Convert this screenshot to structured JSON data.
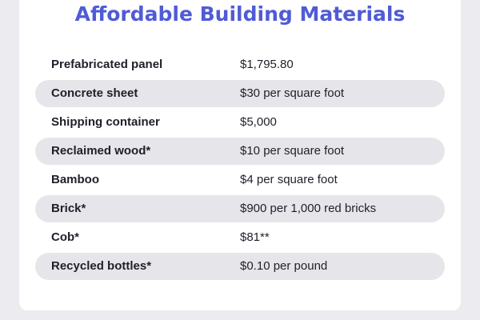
{
  "title": "Affordable Building Materials",
  "colors": {
    "title": "#4f5bd5",
    "row_shade": "#e6e6ea",
    "background": "#ececf0",
    "card": "#ffffff"
  },
  "materials": [
    {
      "name": "Prefabricated panel",
      "price": "$1,795.80"
    },
    {
      "name": "Concrete sheet",
      "price": "$30 per square foot"
    },
    {
      "name": "Shipping container",
      "price": "$5,000"
    },
    {
      "name": "Reclaimed wood*",
      "price": "$10 per square foot"
    },
    {
      "name": "Bamboo",
      "price": "$4 per square foot"
    },
    {
      "name": "Brick*",
      "price": "$900 per 1,000 red bricks"
    },
    {
      "name": "Cob*",
      "price": "$81**"
    },
    {
      "name": "Recycled bottles*",
      "price": "$0.10 per pound"
    }
  ]
}
